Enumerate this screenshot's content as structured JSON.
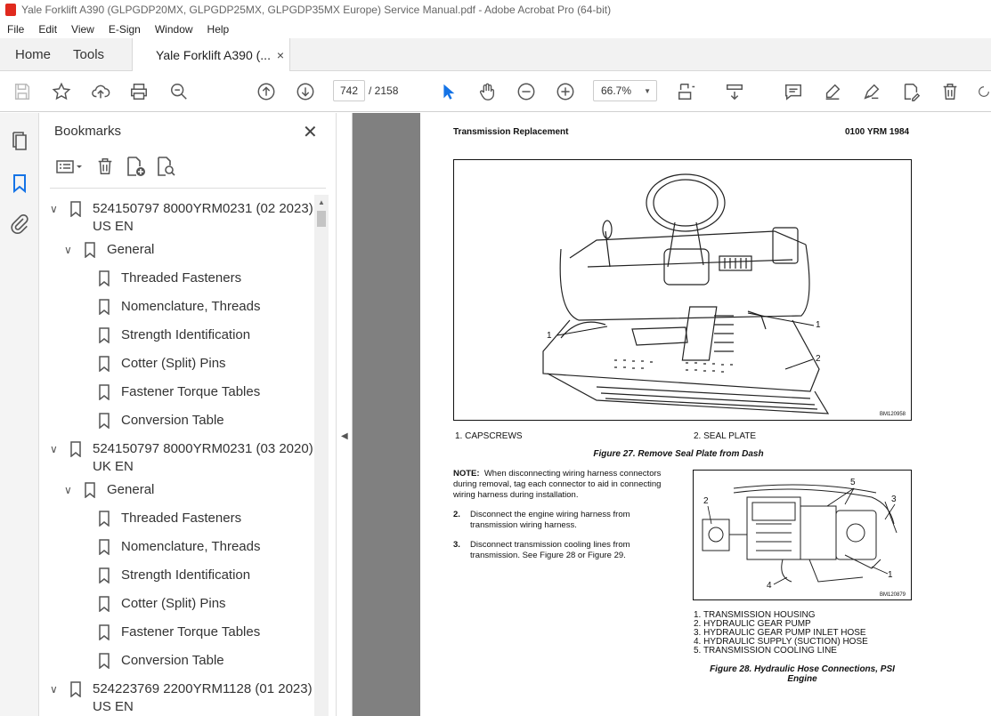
{
  "window": {
    "title": "Yale Forklift A390 (GLPGDP20MX, GLPGDP25MX, GLPGDP35MX Europe) Service Manual.pdf - Adobe Acrobat Pro (64-bit)"
  },
  "menu": [
    "File",
    "Edit",
    "View",
    "E-Sign",
    "Window",
    "Help"
  ],
  "tabs": {
    "home": "Home",
    "tools": "Tools",
    "document": "Yale Forklift A390 (...",
    "close": "×"
  },
  "toolbar": {
    "current_page": "742",
    "total_pages": "/ 2158",
    "zoom": "66.7%"
  },
  "bookmarks": {
    "title": "Bookmarks",
    "close": "✕",
    "items": [
      {
        "label": "524150797 8000YRM0231 (02 2023)",
        "label2": "US EN",
        "level": 0
      },
      {
        "label": "General",
        "level": 1
      },
      {
        "label": "Threaded Fasteners",
        "level": 2
      },
      {
        "label": "Nomenclature, Threads",
        "level": 2
      },
      {
        "label": "Strength Identification",
        "level": 2
      },
      {
        "label": "Cotter (Split) Pins",
        "level": 2
      },
      {
        "label": "Fastener Torque Tables",
        "level": 2
      },
      {
        "label": "Conversion Table",
        "level": 2
      },
      {
        "label": "524150797 8000YRM0231 (03 2020)",
        "label2": "UK EN",
        "level": 0
      },
      {
        "label": "General",
        "level": 1
      },
      {
        "label": "Threaded Fasteners",
        "level": 2
      },
      {
        "label": "Nomenclature, Threads",
        "level": 2
      },
      {
        "label": "Strength Identification",
        "level": 2
      },
      {
        "label": "Cotter (Split) Pins",
        "level": 2
      },
      {
        "label": "Fastener Torque Tables",
        "level": 2
      },
      {
        "label": "Conversion Table",
        "level": 2
      },
      {
        "label": "524223769 2200YRM1128 (01 2023)",
        "label2": "US EN",
        "level": 0
      }
    ]
  },
  "page": {
    "header_left": "Transmission Replacement",
    "header_right": "0100 YRM 1984",
    "fig1_callout_1a": "1",
    "fig1_callout_1b": "1",
    "fig1_callout_2": "2",
    "fig1_id": "BM120958",
    "fig1_legend_1": "1.   CAPSCREWS",
    "fig1_legend_2": "2.   SEAL PLATE",
    "fig1_caption": "Figure 27. Remove Seal Plate from Dash",
    "note_label": "NOTE:",
    "note_text": "When disconnecting wiring harness connectors during removal, tag each connector to aid in connecting wiring harness during installation.",
    "step2_num": "2.",
    "step2_text": "Disconnect the engine wiring harness from transmission wiring harness.",
    "step3_num": "3.",
    "step3_text": "Disconnect transmission cooling lines from transmission. See Figure 28 or Figure 29.",
    "fig2_callouts": [
      "1",
      "2",
      "3",
      "4",
      "5"
    ],
    "fig2_id": "BM120879",
    "fig2_legend": [
      "1.   TRANSMISSION HOUSING",
      "2.   HYDRAULIC GEAR PUMP",
      "3.   HYDRAULIC GEAR PUMP INLET HOSE",
      "4.   HYDRAULIC SUPPLY (SUCTION) HOSE",
      "5.   TRANSMISSION COOLING LINE"
    ],
    "fig2_caption_1": "Figure 28. Hydraulic Hose Connections, PSI",
    "fig2_caption_2": "Engine"
  }
}
